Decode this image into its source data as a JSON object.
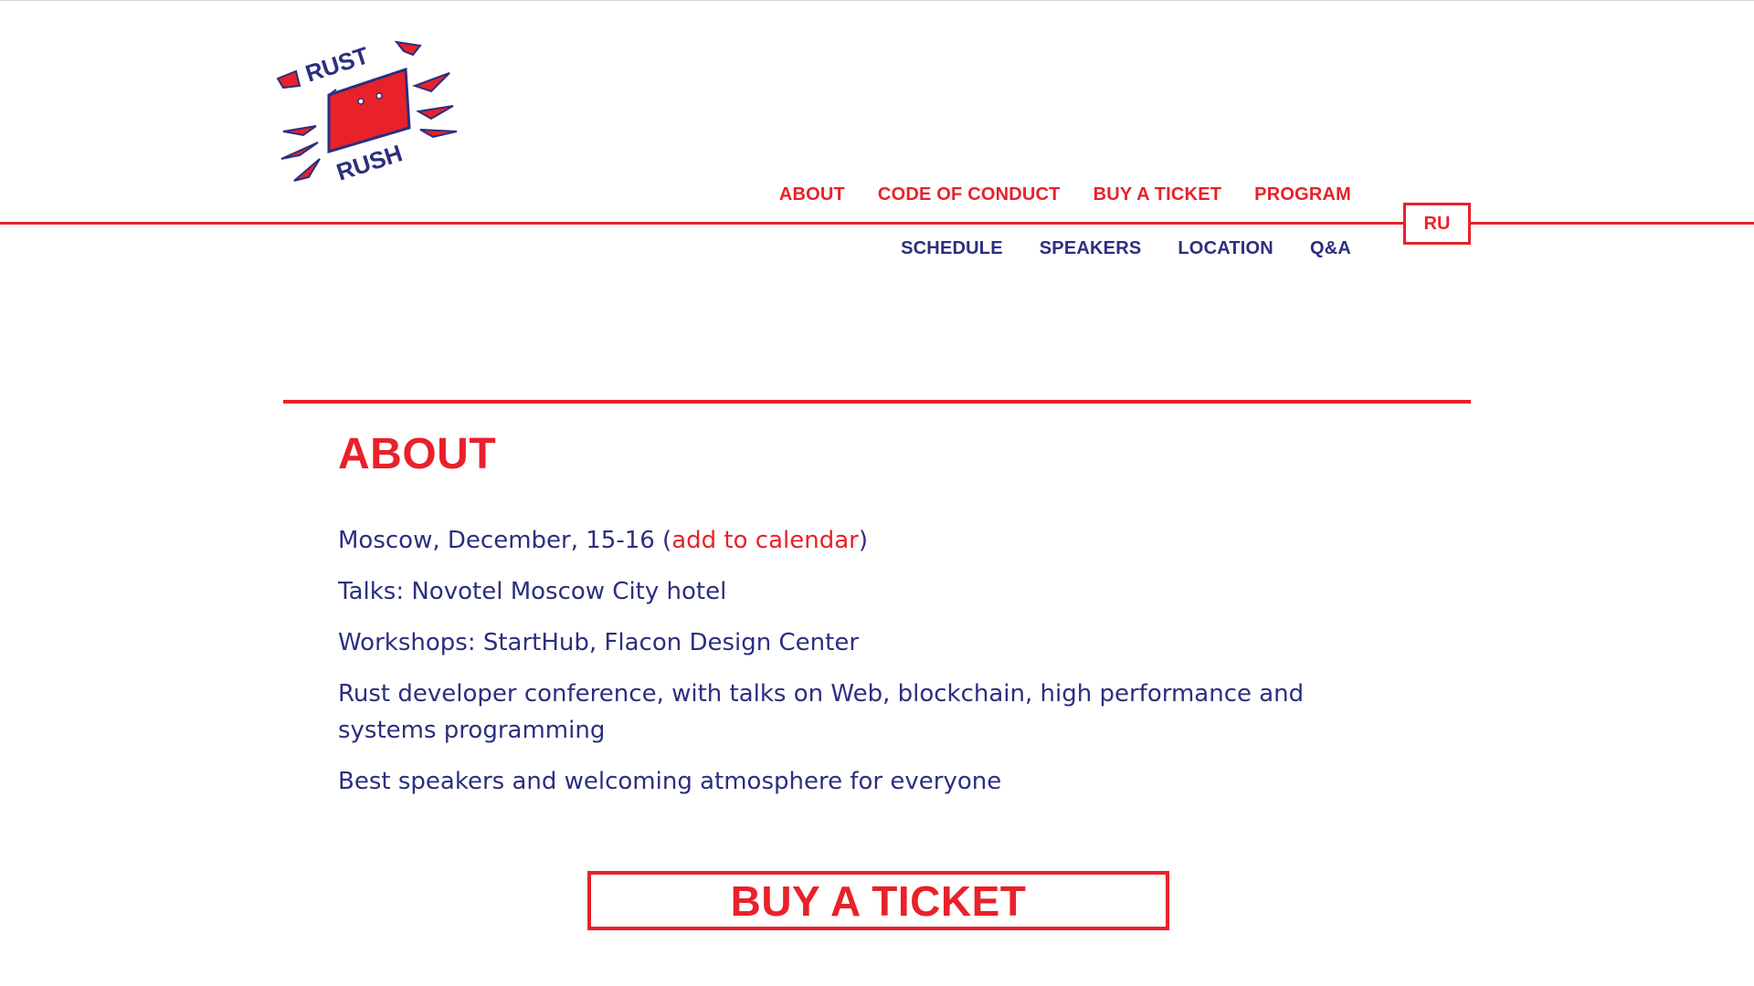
{
  "logo": {
    "top_word": "RUST",
    "bottom_word": "RUSH",
    "colors": {
      "red": "#e8212a",
      "navy": "#2b2f7f"
    }
  },
  "nav": {
    "primary": [
      {
        "label": "ABOUT"
      },
      {
        "label": "CODE OF CONDUCT"
      },
      {
        "label": "BUY A TICKET"
      },
      {
        "label": "PROGRAM"
      }
    ],
    "secondary": [
      {
        "label": "SCHEDULE"
      },
      {
        "label": "SPEAKERS"
      },
      {
        "label": "LOCATION"
      },
      {
        "label": "Q&A"
      }
    ],
    "language_label": "RU"
  },
  "about": {
    "title": "ABOUT",
    "date_text": "Moscow, December, 15-16 (",
    "calendar_link_label": "add to calendar",
    "date_text_end": ")",
    "talks": "Talks: Novotel Moscow City hotel",
    "workshops": "Workshops: StartHub, Flacon Design Center",
    "description": "Rust developer conference, with talks on Web, blockchain, high performance and systems programming",
    "audience": "Best speakers and welcoming atmosphere for everyone"
  },
  "cta": {
    "label": "BUY A TICKET"
  },
  "colors": {
    "accent": "#e8212a",
    "text": "#2b2f7f",
    "background": "#ffffff"
  }
}
